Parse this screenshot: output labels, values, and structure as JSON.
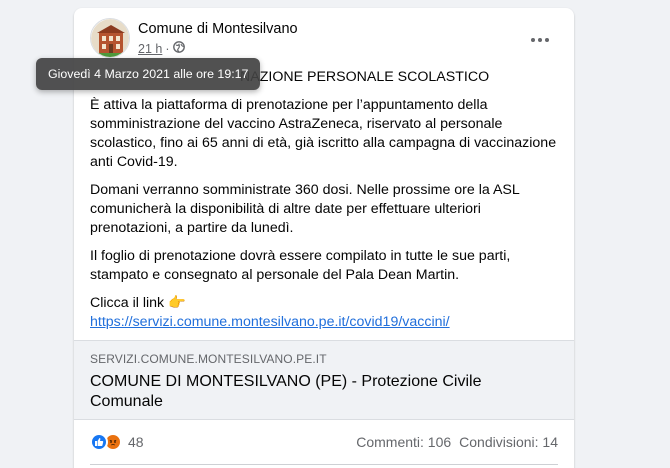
{
  "post": {
    "author": "Comune di Montesilvano",
    "time": "21 h",
    "separator": "·",
    "paragraphs": [
      "NAZIONE PERSONALE SCOLASTICO",
      "È attiva la piattaforma di prenotazione per l’appuntamento della somministrazione del vaccino AstraZeneca, riservato al personale scolastico, fino ai 65 anni di età, già iscritto alla campagna di vaccinazione anti Covid-19.",
      "Domani verranno somministrate 360 dosi. Nelle prossime ore la ASL comunicherà la disponibilità di altre date per effettuare ulteriori prenotazioni, a partire da lunedì.",
      "Il foglio di prenotazione dovrà essere compilato in tutte le sue parti, stampato e consegnato al personale del Pala Dean Martin."
    ],
    "cta_text": "Clicca il link",
    "cta_emoji": "👉",
    "link": "https://servizi.comune.montesilvano.pe.it/covid19/vaccini/"
  },
  "preview": {
    "domain": "SERVIZI.COMUNE.MONTESILVANO.PE.IT",
    "title": "COMUNE DI MONTESILVANO (PE) - Protezione Civile Comunale"
  },
  "footer": {
    "reaction_count": "48",
    "comments": "Commenti: 106",
    "shares": "Condivisioni: 14"
  },
  "tooltip": {
    "text": "Giovedì 4 Marzo 2021 alle ore 19:17"
  },
  "icons": {
    "more": "more-options-icon",
    "privacy": "globe-icon",
    "like": "like-reaction-icon",
    "angry": "angry-reaction-icon"
  },
  "colors": {
    "link": "#216fdb",
    "like": "#1877f2",
    "angry": "#e9710f",
    "tooltip_bg": "#424242"
  }
}
